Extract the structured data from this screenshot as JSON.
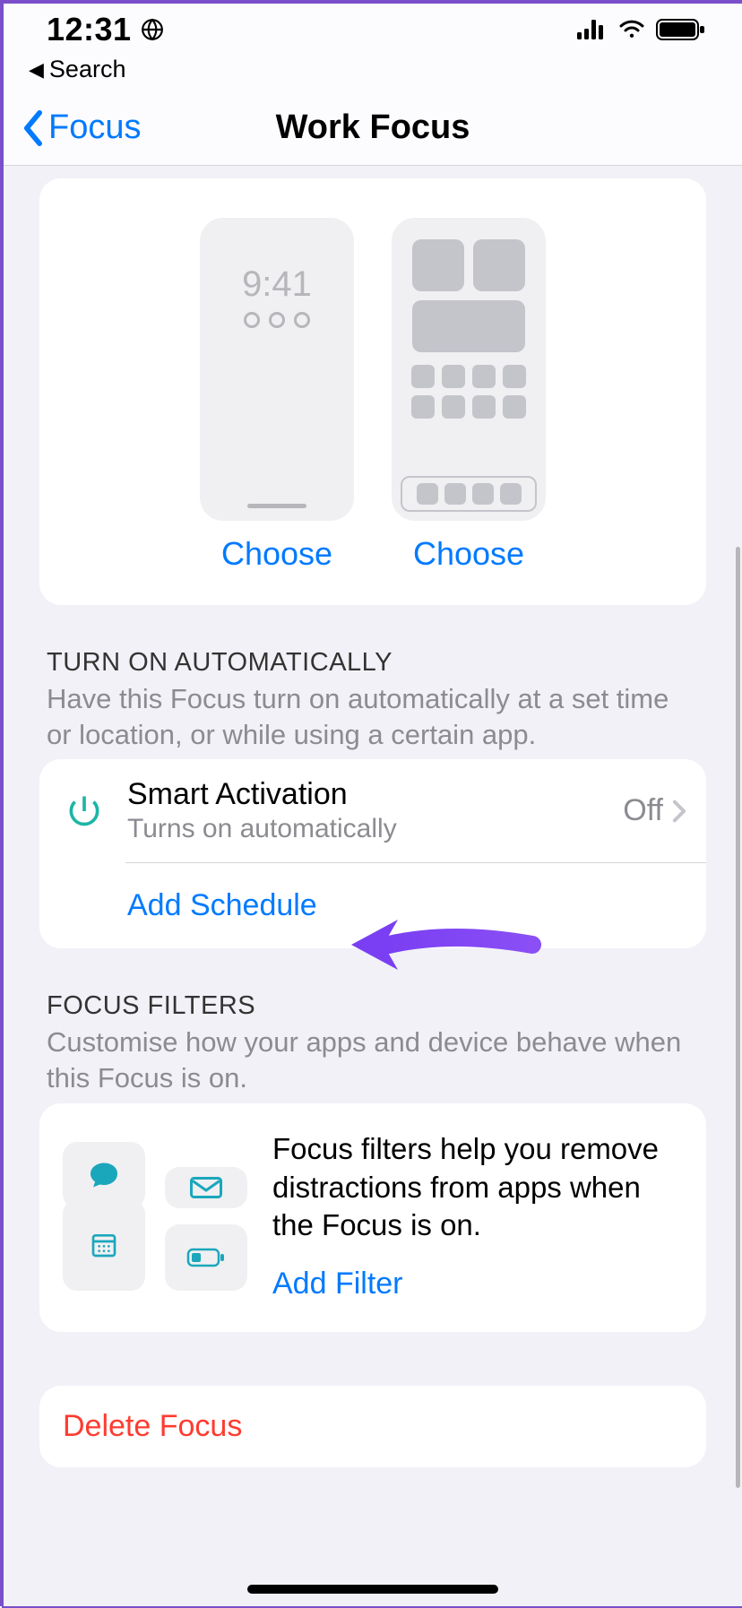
{
  "status": {
    "time": "12:31",
    "signal_bars": 4,
    "wifi_bars": 3,
    "battery_pct": 95
  },
  "breadcrumb": {
    "back_label": "Search"
  },
  "nav": {
    "back_label": "Focus",
    "title": "Work Focus"
  },
  "screens": {
    "lock_time": "9:41",
    "choose_label_1": "Choose",
    "choose_label_2": "Choose"
  },
  "automatic": {
    "header": "TURN ON AUTOMATICALLY",
    "desc": "Have this Focus turn on automatically at a set time or location, or while using a certain app.",
    "smart_title": "Smart Activation",
    "smart_sub": "Turns on automatically",
    "smart_status": "Off",
    "add_schedule_label": "Add Schedule"
  },
  "filters": {
    "header": "FOCUS FILTERS",
    "desc": "Customise how your apps and device behave when this Focus is on.",
    "body": "Focus filters help you remove distractions from apps when the Focus is on.",
    "add_filter_label": "Add Filter"
  },
  "delete": {
    "label": "Delete Focus"
  },
  "colors": {
    "link": "#007aff",
    "teal": "#1db5a6",
    "destructive": "#ff3b30",
    "arrow": "#7a3ff2"
  }
}
